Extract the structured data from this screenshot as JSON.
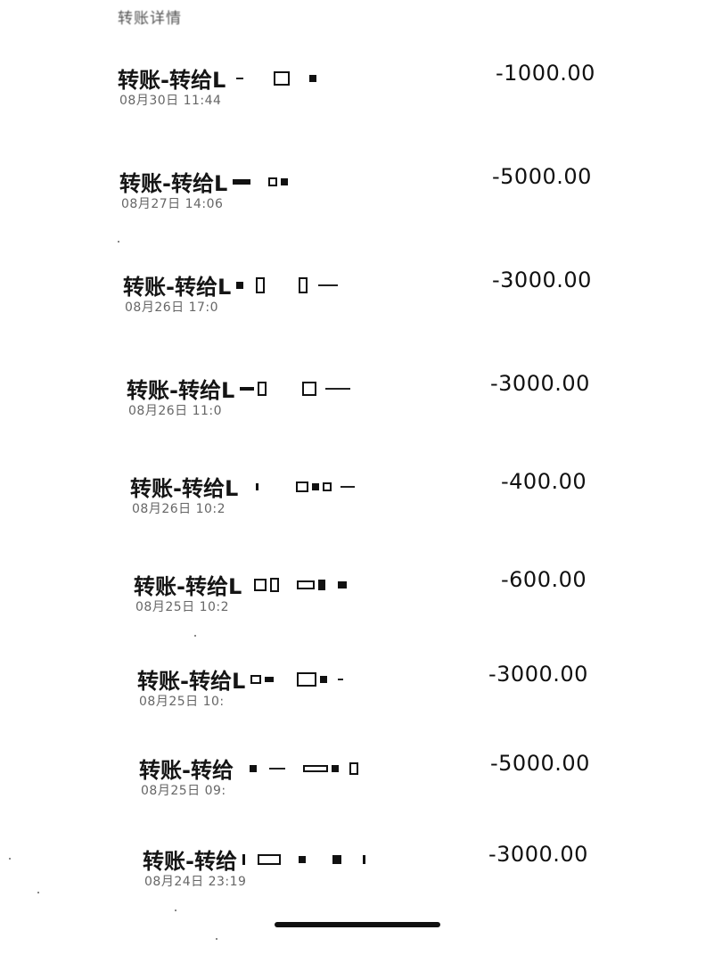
{
  "header": {
    "title": "转账详情"
  },
  "transactions": [
    {
      "title": "转账-转给L",
      "time": "08月30日 11:44",
      "amount": "-1000.00"
    },
    {
      "title": "转账-转给L",
      "time": "08月27日 14:06",
      "amount": "-5000.00"
    },
    {
      "title": "转账-转给L",
      "time": "08月26日 17:0",
      "amount": "-3000.00"
    },
    {
      "title": "转账-转给L",
      "time": "08月26日 11:0",
      "amount": "-3000.00"
    },
    {
      "title": "转账-转给L",
      "time": "08月26日 10:2",
      "amount": "-400.00"
    },
    {
      "title": "转账-转给L",
      "time": "08月25日 10:2",
      "amount": "-600.00"
    },
    {
      "title": "转账-转给L",
      "time": "08月25日 10:",
      "amount": "-3000.00"
    },
    {
      "title": "转账-转给",
      "time": "08月25日 09:",
      "amount": "-5000.00"
    },
    {
      "title": "转账-转给",
      "time": "08月24日 23:19",
      "amount": "-3000.00"
    }
  ]
}
